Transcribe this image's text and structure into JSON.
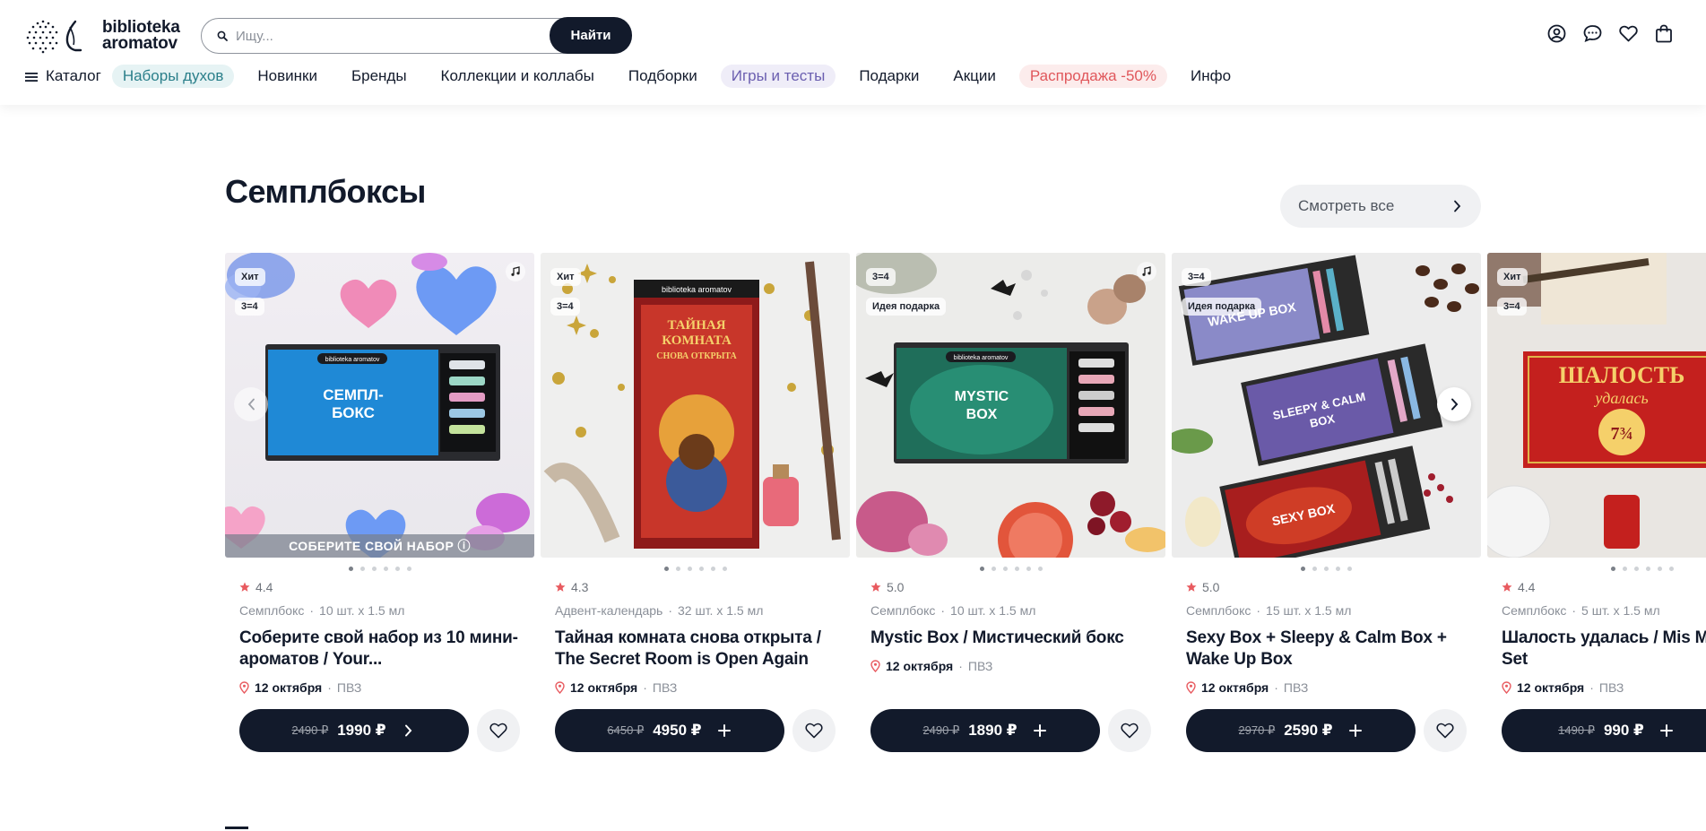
{
  "brand": {
    "line1": "biblioteka",
    "line2": "aromatov"
  },
  "search": {
    "placeholder": "Ищу...",
    "button_label": "Найти"
  },
  "header_icons": [
    "account-icon",
    "chat-icon",
    "heart-icon",
    "bag-icon"
  ],
  "nav": {
    "items": [
      {
        "label": "Каталог"
      },
      {
        "label": "Наборы духов",
        "pill_bg": "#e6f3f4",
        "color": "#2a7f8a"
      },
      {
        "label": "Новинки"
      },
      {
        "label": "Бренды"
      },
      {
        "label": "Коллекции и коллабы"
      },
      {
        "label": "Подборки"
      },
      {
        "label": "Игры и тесты",
        "pill_bg": "#efedf8",
        "color": "#6b5fb0"
      },
      {
        "label": "Подарки"
      },
      {
        "label": "Акции"
      },
      {
        "label": "Распродажа -50%",
        "pill_bg": "#fcecec",
        "color": "#e0575b"
      },
      {
        "label": "Инфо"
      }
    ]
  },
  "section": {
    "title": "Семплбоксы",
    "see_all": "Смотреть все"
  },
  "cards": [
    {
      "badges": [
        "Хит",
        "3=4"
      ],
      "music": true,
      "banner": "СОБЕРИТЕ СВОЙ НАБОР ⓘ",
      "dots_count": 6,
      "active_dot": 0,
      "rating": "4.4",
      "type": "Семплбокс",
      "volume": "10 шт. x 1.5 мл",
      "title": "Соберите свой набор из 10 мини-ароматов / Your...",
      "date": "12 октября",
      "pickup": "ПВЗ",
      "old_price": "2490 ₽",
      "price": "1990 ₽",
      "action": "arrow",
      "image_theme": "blue"
    },
    {
      "badges": [
        "Хит",
        "3=4"
      ],
      "music": false,
      "banner": "",
      "dots_count": 6,
      "active_dot": 0,
      "rating": "4.3",
      "type": "Адвент-календарь",
      "volume": "32 шт. x 1.5 мл",
      "title": "Тайная комната снова открыта / The Secret Room is Open Again",
      "date": "12 октября",
      "pickup": "ПВЗ",
      "old_price": "6450 ₽",
      "price": "4950 ₽",
      "action": "plus",
      "image_theme": "gold",
      "box_label": "biblioteka aromatov",
      "box_text": "ТАЙНАЯ КОМНАТА СНОВА ОТКРЫТА"
    },
    {
      "badges": [
        "3=4",
        "Идея подарка"
      ],
      "music": true,
      "banner": "",
      "dots_count": 6,
      "active_dot": 0,
      "rating": "5.0",
      "type": "Семплбокс",
      "volume": "10 шт. x 1.5 мл",
      "title": "Mystic Box / Мистический бокс",
      "date": "12 октября",
      "pickup": "ПВЗ",
      "old_price": "2490 ₽",
      "price": "1890 ₽",
      "action": "plus",
      "image_theme": "mystic",
      "box_text": "MYSTIC BOX"
    },
    {
      "badges": [
        "3=4",
        "Идея подарка"
      ],
      "music": false,
      "banner": "",
      "dots_count": 5,
      "active_dot": 0,
      "rating": "5.0",
      "type": "Семплбокс",
      "volume": "15 шт. x 1.5 мл",
      "title": "Sexy Box + Sleepy & Calm Box + Wake Up Box",
      "date": "12 октября",
      "pickup": "ПВЗ",
      "old_price": "2970 ₽",
      "price": "2590 ₽",
      "action": "plus",
      "image_theme": "trio",
      "box_texts": [
        "WAKE UP BOX",
        "SLEEPY & CALM BOX",
        "SEXY BOX"
      ]
    },
    {
      "badges": [
        "Хит",
        "3=4"
      ],
      "music": false,
      "banner": "",
      "dots_count": 6,
      "active_dot": 0,
      "rating": "4.4",
      "type": "Семплбокс",
      "volume": "5 шт. x 1.5 мл",
      "title": "Шалость удалась / Mis Managed Set",
      "date": "12 октября",
      "pickup": "ПВЗ",
      "old_price": "1490 ₽",
      "price": "990 ₽",
      "action": "plus",
      "image_theme": "red",
      "box_text": "ШАЛОСТЬ удалась"
    }
  ],
  "colors": {
    "dark": "#121a2b",
    "star": "#e85a5f",
    "pin": "#e85a5f"
  }
}
